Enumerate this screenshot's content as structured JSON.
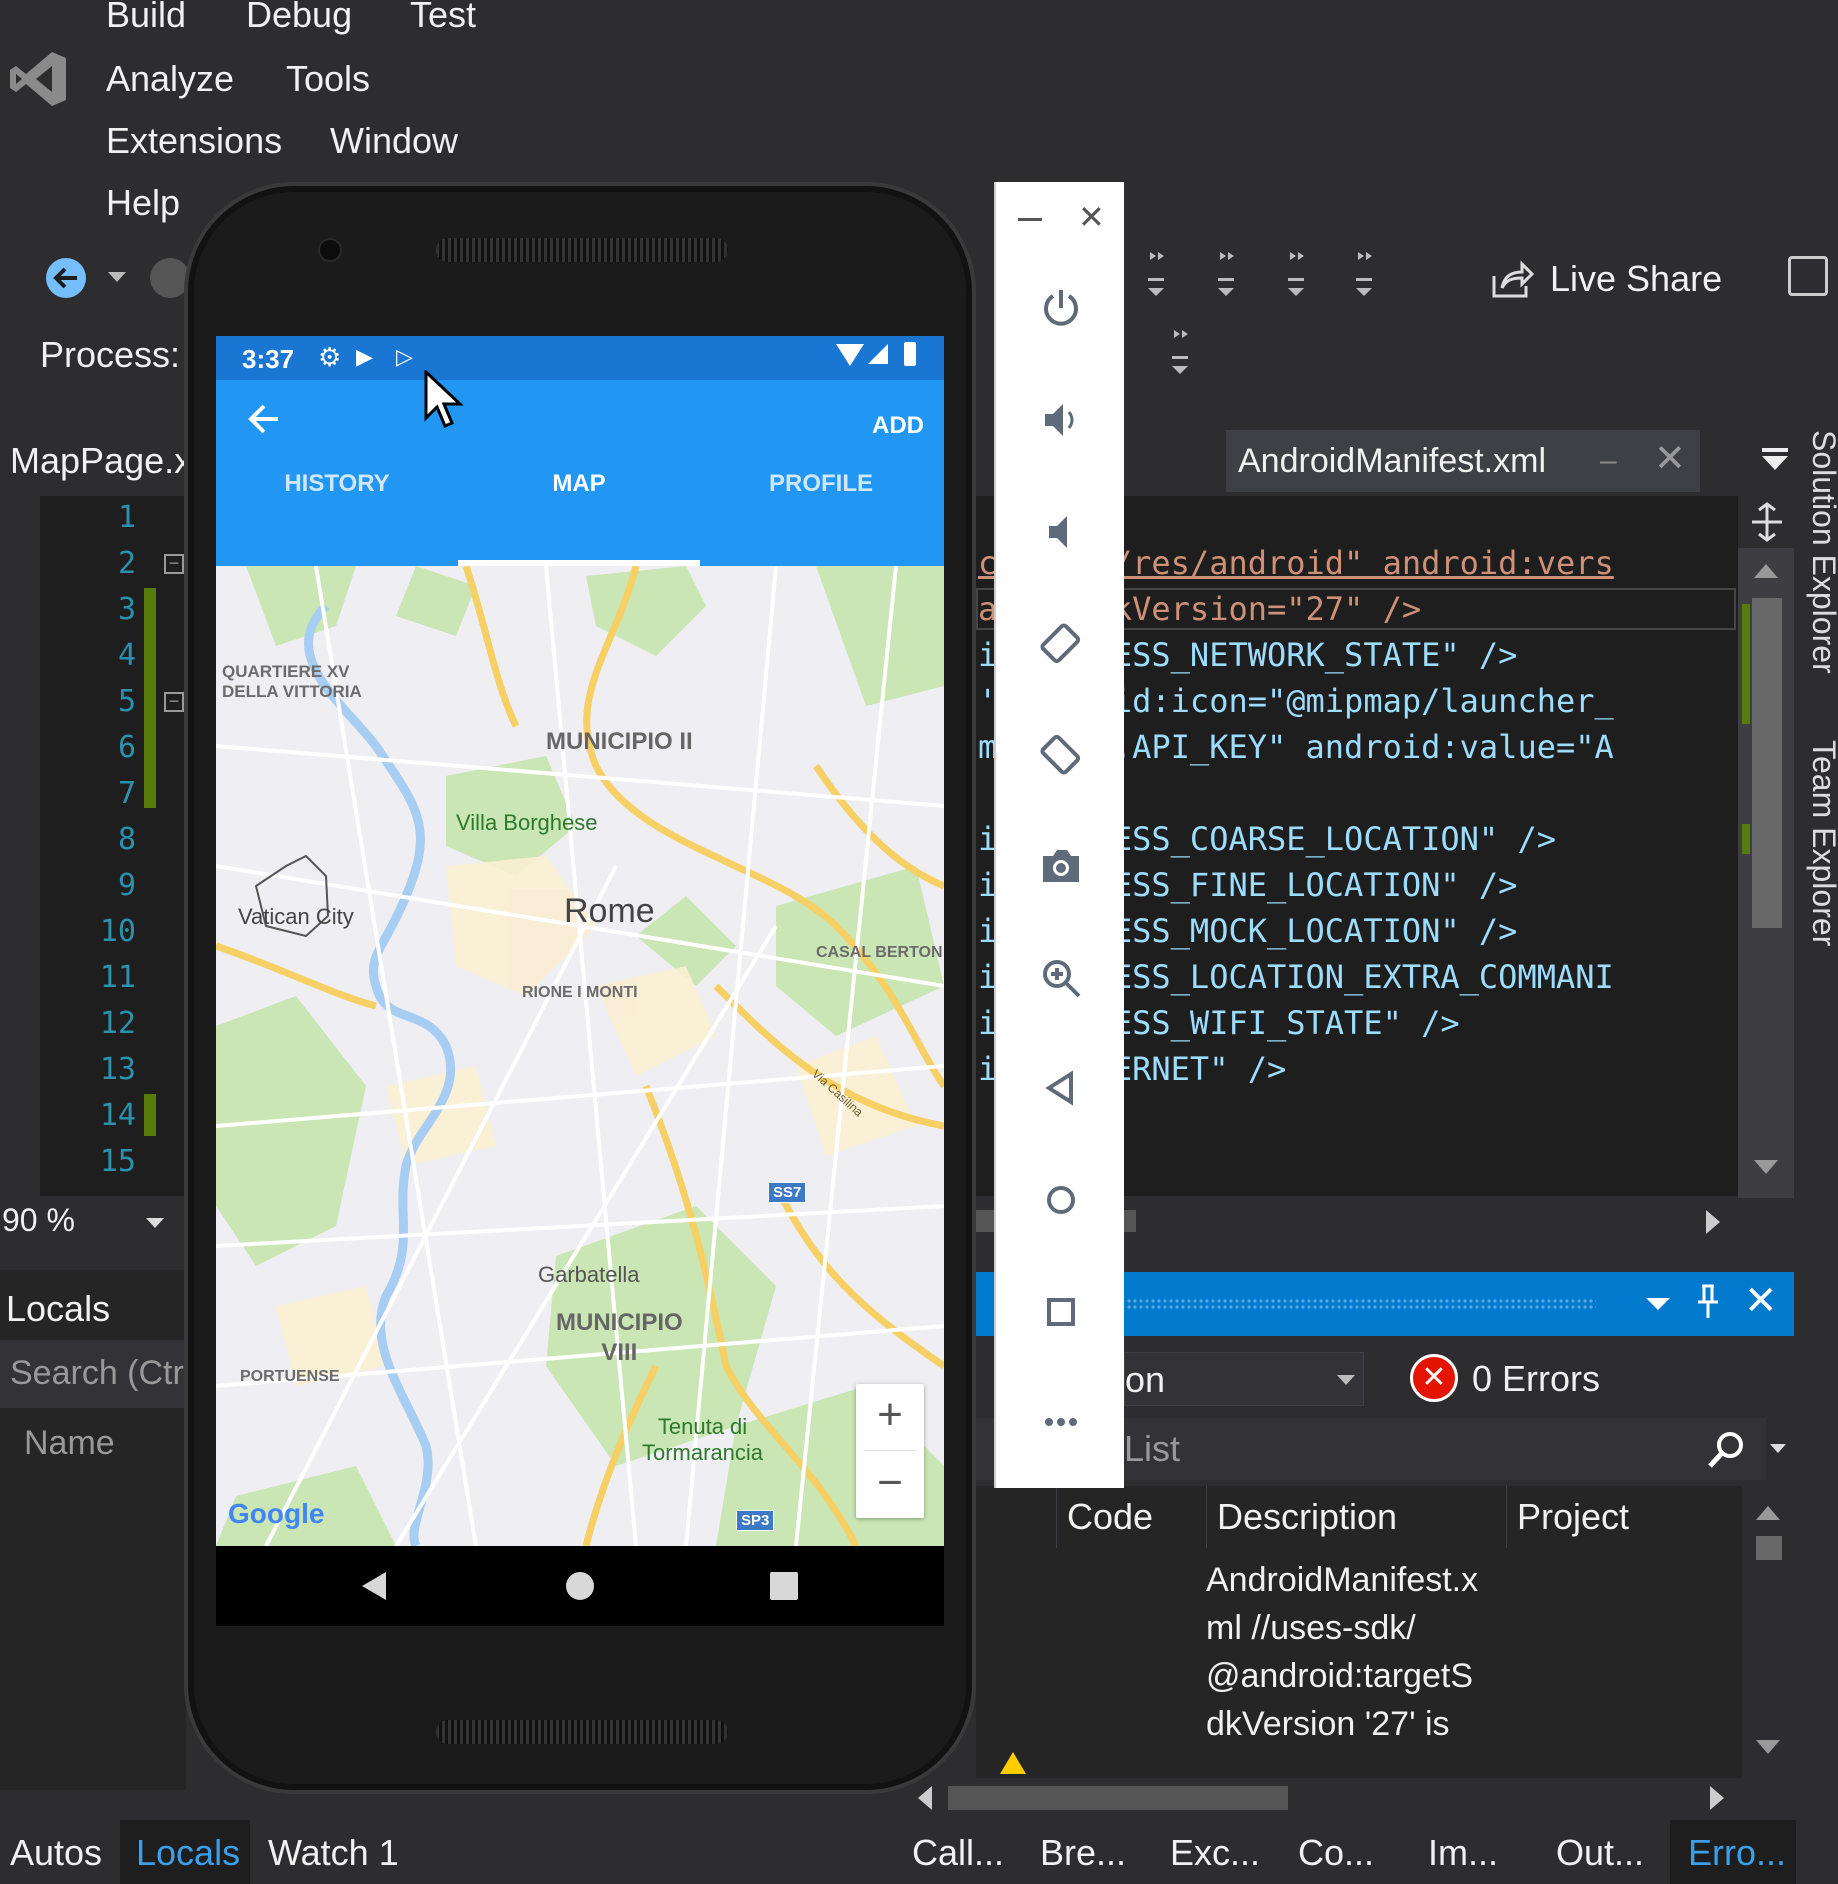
{
  "menu": {
    "items": [
      "Build",
      "Debug",
      "Test",
      "Analyze",
      "Tools",
      "Extensions",
      "Window",
      "Help"
    ]
  },
  "toolbar": {
    "process_label": "Process:",
    "live_share": "Live Share"
  },
  "editor_tabs": {
    "left_tab": "MapPage.x",
    "right_tab": "AndroidManifest.xml"
  },
  "editor": {
    "line_numbers": [
      "1",
      "2",
      "3",
      "4",
      "5",
      "6",
      "7",
      "8",
      "9",
      "10",
      "11",
      "12",
      "13",
      "14",
      "15"
    ],
    "zoom": "90 %",
    "code_lines": [
      "com/apk/res/android\" android:vers",
      "argetSdkVersion=\"27\" />",
      "ion.ACCESS_NETWORK_STATE\" />",
      "' android:icon=\"@mipmap/launcher_",
      "maps.v2.API_KEY\" android:value=\"A",
      "",
      "ion.ACCESS_COARSE_LOCATION\" />",
      "ion.ACCESS_FINE_LOCATION\" />",
      "ion.ACCESS_MOCK_LOCATION\" />",
      "ion.ACCESS_LOCATION_EXTRA_COMMANI",
      "ion.ACCESS_WIFI_STATE\" />",
      "ion.INTERNET\" />"
    ]
  },
  "locals_panel": {
    "title": "Locals",
    "search_placeholder": "Search (Ctr",
    "name_header": "Name"
  },
  "error_list": {
    "scope_value": "on",
    "errors_label": "0 Errors",
    "search_placeholder": "List",
    "columns": [
      "Code",
      "Description",
      "Project"
    ],
    "description_lines": [
      "AndroidManifest.x",
      "ml //uses-sdk/",
      "@android:targetS",
      "dkVersion '27' is"
    ]
  },
  "bottom_tabs_left": [
    "Autos",
    "Locals",
    "Watch 1"
  ],
  "bottom_tabs_right": [
    "Call...",
    "Bre...",
    "Exc...",
    "Co...",
    "Im...",
    "Out...",
    "Erro..."
  ],
  "side_tabs": [
    "Solution Explorer",
    "Team Explorer"
  ],
  "phone": {
    "status_time": "3:37",
    "app_action": "ADD",
    "tabs": [
      "HISTORY",
      "MAP",
      "PROFILE"
    ],
    "selected_tab": "MAP",
    "map_labels": {
      "quartiere": "QUARTIERE XV",
      "quartiere2": "DELLA VITTORIA",
      "municipio2": "MUNICIPIO II",
      "villa": "Villa Borghese",
      "vatican": "Vatican City",
      "rome": "Rome",
      "casal": "CASAL BERTON",
      "rione": "RIONE I MONTI",
      "via": "Via Casilina",
      "ss7": "SS7",
      "garbatella": "Garbatella",
      "municipio8a": "MUNICIPIO",
      "municipio8b": "VIII",
      "portuense": "PORTUENSE",
      "tenuta1": "Tenuta di",
      "tenuta2": "Tormarancia",
      "sp3": "SP3",
      "google": "Google",
      "zoom_in": "+",
      "zoom_out": "−"
    }
  },
  "colors": {
    "vs_background": "#2d2d30",
    "editor_bg": "#1e1e1e",
    "accent": "#007acc",
    "app_primary": "#2196f3",
    "app_status": "#1976d2",
    "error_red": "#e51400"
  }
}
